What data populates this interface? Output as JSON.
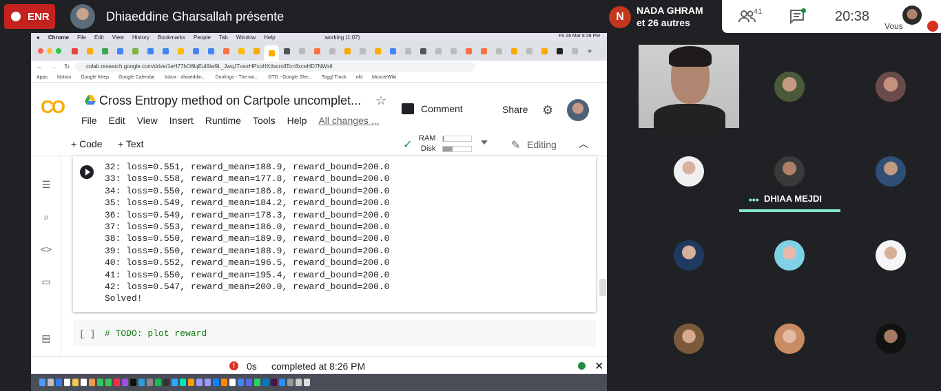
{
  "meet": {
    "recording_label": "ENR",
    "presenter_title": "Dhiaeddine Gharsallah présente",
    "participant_initial": "N",
    "participant_name": "NADA GHRAM",
    "participant_others": "et 26 autres",
    "people_count": "41",
    "clock": "20:38",
    "self_label": "Vous",
    "speaker_name": "DHIAA MEJDI",
    "speaker_dots": "•••"
  },
  "mac": {
    "app_name": "Chrome",
    "menu": [
      "File",
      "Edit",
      "View",
      "History",
      "Bookmarks",
      "People",
      "Tab",
      "Window",
      "Help"
    ],
    "status": "working (1:07)",
    "datetime": "Fri 26 Mar  8:38 PM"
  },
  "browser": {
    "url": "colab.research.google.com/drive/1eH77hOl9qEuI9iw9L_JwqJTvsrrHPxoHX#scrollTo=8xceHD7NWxtl",
    "bookmarks": [
      "Apps",
      "Notion",
      "Google Keep",
      "Google Calendar",
      "Inbox - dhiaeddin...",
      "Duolingo - The wo...",
      "GTD - Google She...",
      "Toggl Track",
      "old",
      "MuscleWiki"
    ]
  },
  "colab": {
    "logo_text": "CO",
    "title": "Cross Entropy method on Cartpole uncomplet...",
    "menu": [
      "File",
      "Edit",
      "View",
      "Insert",
      "Runtime",
      "Tools",
      "Help"
    ],
    "all_changes": "All changes ...",
    "comment": "Comment",
    "share": "Share",
    "add_code": "+ Code",
    "add_text": "+ Text",
    "ram": "RAM",
    "disk": "Disk",
    "ram_usage": 0.05,
    "disk_usage": 0.35,
    "editing": "Editing",
    "output": "32: loss=0.551, reward_mean=188.9, reward_bound=200.0\n33: loss=0.558, reward_mean=177.8, reward_bound=200.0\n34: loss=0.550, reward_mean=186.8, reward_bound=200.0\n35: loss=0.549, reward_mean=184.2, reward_bound=200.0\n36: loss=0.549, reward_mean=178.3, reward_bound=200.0\n37: loss=0.553, reward_mean=186.0, reward_bound=200.0\n38: loss=0.550, reward_mean=189.0, reward_bound=200.0\n39: loss=0.550, reward_mean=188.9, reward_bound=200.0\n40: loss=0.552, reward_mean=196.5, reward_bound=200.0\n41: loss=0.550, reward_mean=195.4, reward_bound=200.0\n42: loss=0.547, reward_mean=200.0, reward_bound=200.0\nSolved!",
    "cell2_bracket": "[ ]",
    "cell2_code": "# TODO: plot reward",
    "status_time": "0s",
    "status_text": "completed at 8:26 PM"
  },
  "colors": {
    "record_red": "#c5221f",
    "speaker_accent": "#81e5cf",
    "colab_orange": "#f9ab00"
  }
}
